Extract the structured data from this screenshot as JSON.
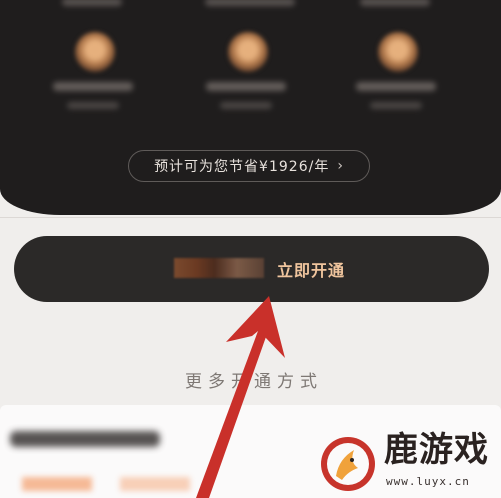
{
  "dark_panel": {
    "benefits": [
      {
        "icon": "benefit-icon-1"
      },
      {
        "icon": "benefit-icon-2"
      },
      {
        "icon": "benefit-icon-3"
      }
    ],
    "save_text": "预计可为您节省¥1926/年",
    "save_chevron": "›"
  },
  "open_button": {
    "label": "立即开通"
  },
  "more_methods": {
    "label": "更多开通方式"
  },
  "watermark": {
    "title": "鹿游戏",
    "url": "www.luyx.cn"
  },
  "colors": {
    "dark_bg": "#1f1d1d",
    "button_bg": "#2b2928",
    "button_text": "#f0c59e",
    "arrow": "#c9302a",
    "page_bg": "#f0eeec"
  }
}
